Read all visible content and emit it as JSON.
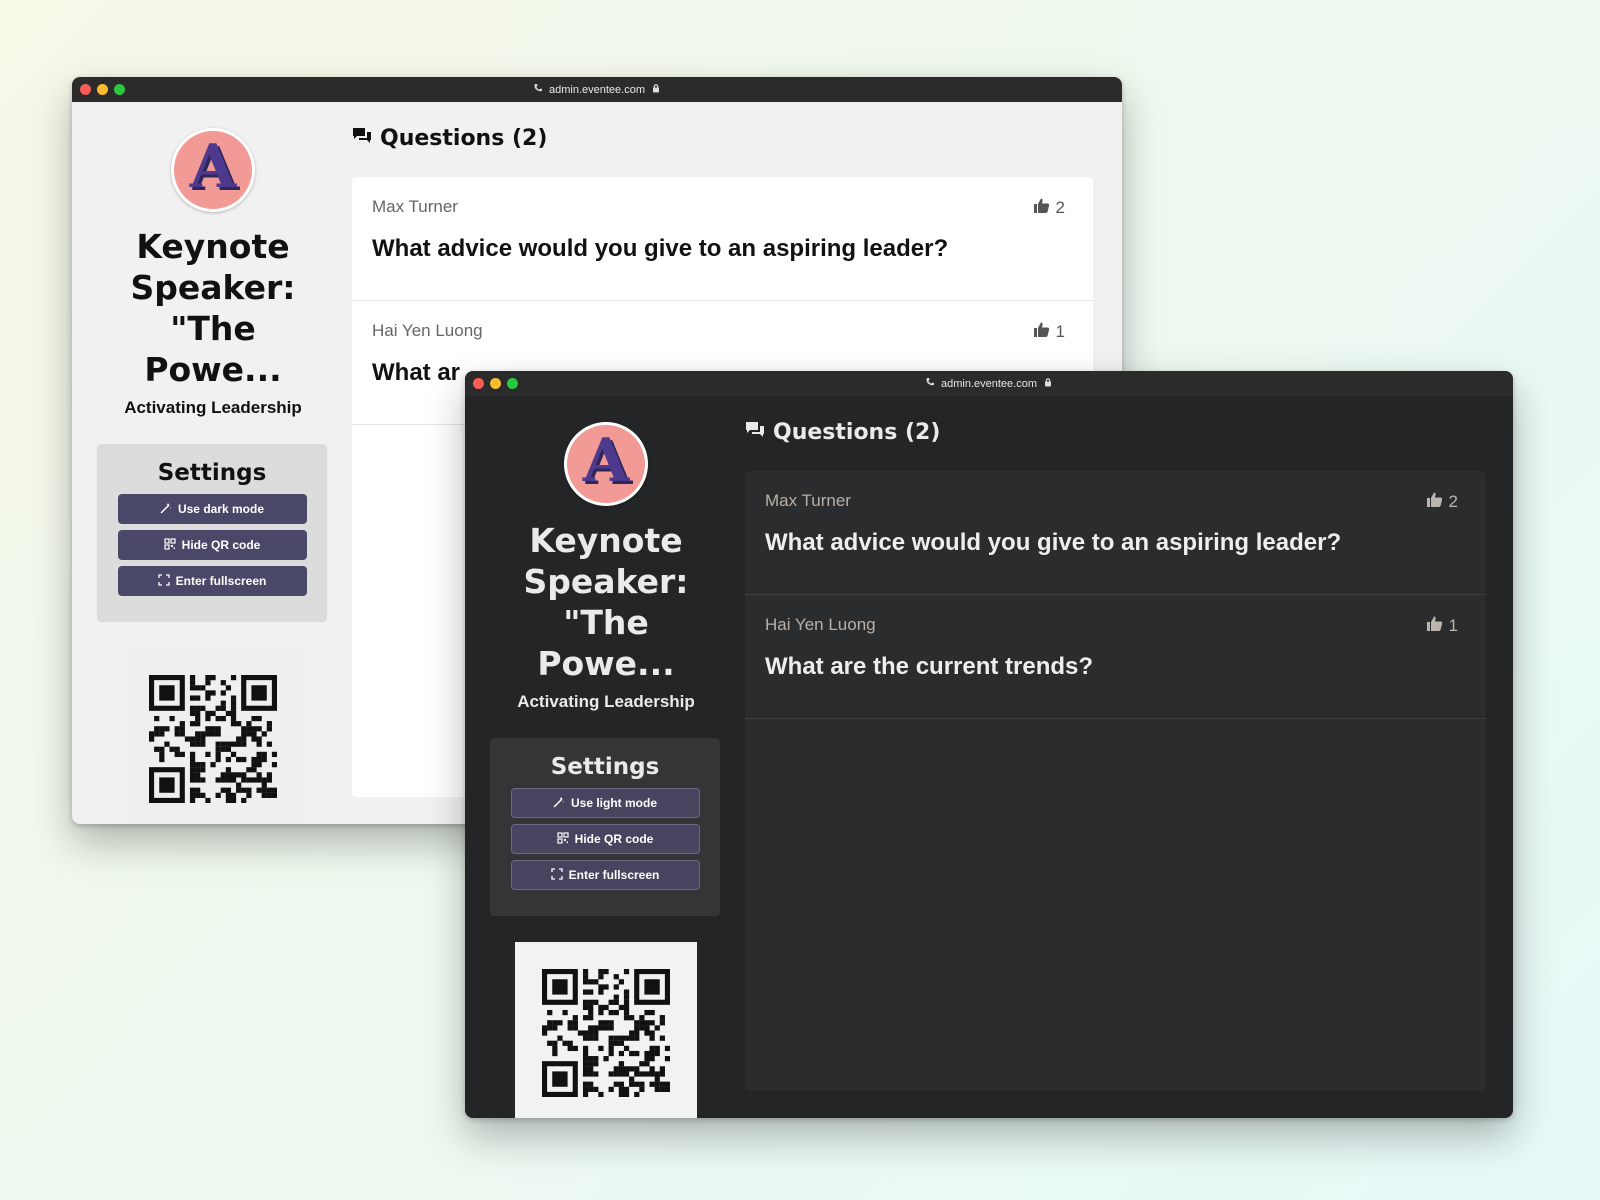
{
  "light_window": {
    "url": "admin.eventee.com",
    "avatar_letter": "A",
    "talk_title": "Keynote Speaker: \"The Powe...",
    "talk_subtitle": "Activating Leadership",
    "settings": {
      "title": "Settings",
      "mode_button": "Use dark mode",
      "qr_button": "Hide QR code",
      "fullscreen_button": "Enter fullscreen"
    },
    "questions_header": "Questions (2)",
    "questions": [
      {
        "author": "Max Turner",
        "text": "What advice would you give to an aspiring leader?",
        "likes": "2"
      },
      {
        "author": "Hai Yen Luong",
        "text": "What ar",
        "likes": "1"
      }
    ]
  },
  "dark_window": {
    "url": "admin.eventee.com",
    "avatar_letter": "A",
    "talk_title": "Keynote Speaker: \"The Powe...",
    "talk_subtitle": "Activating Leadership",
    "settings": {
      "title": "Settings",
      "mode_button": "Use light mode",
      "qr_button": "Hide QR code",
      "fullscreen_button": "Enter fullscreen"
    },
    "questions_header": "Questions (2)",
    "questions": [
      {
        "author": "Max Turner",
        "text": "What advice would you give to an aspiring leader?",
        "likes": "2"
      },
      {
        "author": "Hai Yen Luong",
        "text": "What are the current trends?",
        "likes": "1"
      }
    ]
  },
  "icons": [
    "phone-icon",
    "lock-icon",
    "chat-icon",
    "thumbs-up-icon",
    "magic-wand-icon",
    "qr-code-icon",
    "fullscreen-icon"
  ],
  "colors": {
    "button_light": "#4a4868",
    "button_dark": "#46445e",
    "avatar_bg": "#f29a96",
    "avatar_letter": "#4d3a8f",
    "dark_bg": "#242526",
    "light_bg": "#f1f1f1"
  }
}
